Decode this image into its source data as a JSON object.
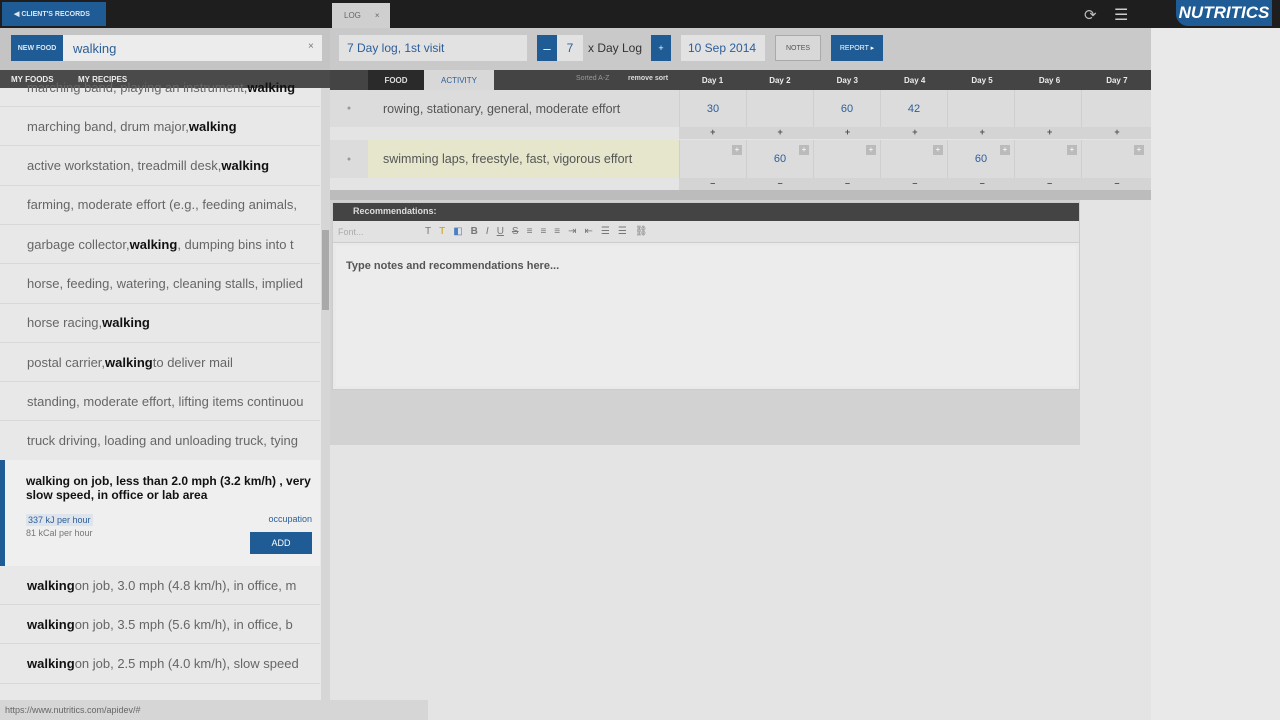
{
  "topbar": {
    "back_label": "◀ CLIENT'S RECORDS",
    "log_tab": "LOG",
    "log_tab_close": "×",
    "logo": "NUTRITICS",
    "refresh_icon": "refresh-icon",
    "menu_icon": "hamburger-icon"
  },
  "search": {
    "new_food": "NEW FOOD",
    "value": "walking",
    "clear": "×"
  },
  "left_tabs": [
    "MY FOODS",
    "MY RECIPES"
  ],
  "list": [
    {
      "bold_first": false,
      "pre": "marching band, playing an instrument, ",
      "bold": "walking",
      "post": ""
    },
    {
      "bold_first": false,
      "pre": "marching band, drum major, ",
      "bold": "walking",
      "post": ""
    },
    {
      "bold_first": false,
      "pre": "active workstation, treadmill desk, ",
      "bold": "walking",
      "post": ""
    },
    {
      "bold_first": false,
      "pre": "farming, moderate effort (e.g., feeding animals, ",
      "bold": "",
      "post": ""
    },
    {
      "bold_first": false,
      "pre": "garbage collector, ",
      "bold": "walking",
      "post": ", dumping bins into t"
    },
    {
      "bold_first": false,
      "pre": "horse, feeding, watering, cleaning stalls, implied",
      "bold": "",
      "post": ""
    },
    {
      "bold_first": false,
      "pre": "horse racing, ",
      "bold": "walking",
      "post": ""
    },
    {
      "bold_first": false,
      "pre": "postal carrier, ",
      "bold": "walking",
      "post": " to deliver mail"
    },
    {
      "bold_first": false,
      "pre": "standing, moderate effort, lifting items continuou",
      "bold": "",
      "post": ""
    },
    {
      "bold_first": false,
      "pre": "truck driving, loading and unloading truck, tying",
      "bold": "",
      "post": ""
    }
  ],
  "selected": {
    "title": "walking on job, less than 2.0 mph (3.2 km/h) , very slow speed, in office or lab area",
    "kj": "337 kJ per hour",
    "kcal": "81 kCal per hour",
    "category": "occupation",
    "add": "ADD"
  },
  "list_after": [
    {
      "bold": "walking",
      "post": " on job, 3.0 mph (4.8 km/h), in office, m"
    },
    {
      "bold": "walking",
      "post": " on job, 3.5 mph (5.6 km/h), in office, b"
    },
    {
      "bold": "walking",
      "post": " on job, 2.5 mph (4.0 km/h), slow speed"
    }
  ],
  "log": {
    "name": "7 Day log, 1st visit",
    "minus": "–",
    "days": "7",
    "x_label": "x Day Log",
    "plus": "+",
    "date": "10 Sep 2014",
    "notes": "NOTES",
    "report": "REPORT ▸"
  },
  "table": {
    "tabs": [
      "FOOD",
      "ACTIVITY"
    ],
    "sorted": "Sorted A-Z",
    "remove_sort": "remove sort",
    "days": [
      "Day 1",
      "Day 2",
      "Day 3",
      "Day 4",
      "Day 5",
      "Day 6",
      "Day 7"
    ],
    "rows": [
      {
        "name": "rowing, stationary, general, moderate effort",
        "values": [
          "30",
          "",
          "60",
          "42",
          "",
          "",
          ""
        ]
      },
      {
        "name": "swimming laps, freestyle, fast, vigorous effort",
        "values": [
          "",
          "60",
          "",
          "",
          "60",
          "",
          ""
        ]
      }
    ]
  },
  "recommendations": {
    "header": "Recommendations:",
    "font_placeholder": "Font...",
    "placeholder": "Type notes and recommendations here..."
  },
  "status_url": "https://www.nutritics.com/apidev/#"
}
